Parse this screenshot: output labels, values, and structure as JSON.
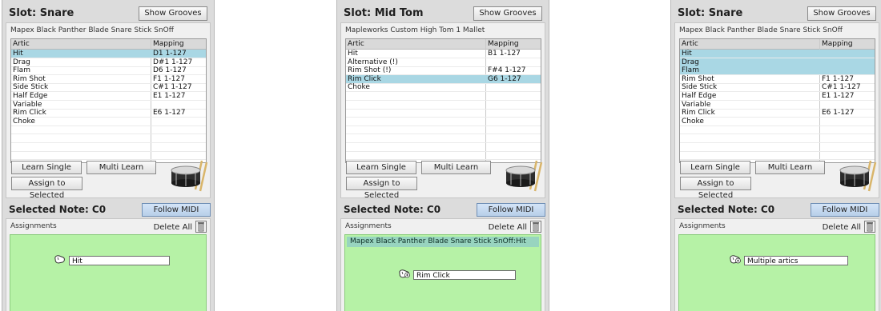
{
  "common": {
    "show_grooves": "Show Grooves",
    "col_artic": "Artic",
    "col_mapping": "Mapping",
    "learn_single": "Learn Single",
    "multi_learn": "Multi Learn",
    "assign_to_selected": "Assign to Selected",
    "selected_note": "Selected Note: C0",
    "follow_midi": "Follow MIDI",
    "assignments": "Assignments",
    "delete_all": "Delete All"
  },
  "colors": {
    "selected_row": "#a9d7e4",
    "drop_zone": "#b6f2a6",
    "assigned_item": "#98d4bf",
    "follow_button": "#c6dbf1"
  },
  "panels": [
    {
      "slot_title": "Slot: Snare",
      "kit_name": "Mapex Black Panther Blade Snare Stick SnOff",
      "rows": [
        {
          "artic": "Hit",
          "mapping": "D1 1-127",
          "selected": true
        },
        {
          "artic": "Drag",
          "mapping": "D#1 1-127",
          "selected": false
        },
        {
          "artic": "Flam",
          "mapping": "D6 1-127",
          "selected": false
        },
        {
          "artic": "Rim Shot",
          "mapping": "F1 1-127",
          "selected": false
        },
        {
          "artic": "Side Stick",
          "mapping": "C#1 1-127",
          "selected": false
        },
        {
          "artic": "Half Edge",
          "mapping": "E1 1-127",
          "selected": false
        },
        {
          "artic": "Variable",
          "mapping": "",
          "selected": false
        },
        {
          "artic": "Rim Click",
          "mapping": "E6 1-127",
          "selected": false
        },
        {
          "artic": "Choke",
          "mapping": "",
          "selected": false
        }
      ],
      "assigned_item": "",
      "drag_label": "Hit",
      "drag_plus": false
    },
    {
      "slot_title": "Slot: Mid Tom",
      "kit_name": "Mapleworks Custom High Tom 1 Mallet",
      "rows": [
        {
          "artic": "Hit",
          "mapping": "B1 1-127",
          "selected": false
        },
        {
          "artic": "Alternative (!)",
          "mapping": "",
          "selected": false
        },
        {
          "artic": "Rim Shot (!)",
          "mapping": "F#4 1-127",
          "selected": false
        },
        {
          "artic": "Rim Click",
          "mapping": "G6 1-127",
          "selected": true
        },
        {
          "artic": "Choke",
          "mapping": "",
          "selected": false
        }
      ],
      "assigned_item": "Mapex Black Panther Blade Snare Stick SnOff:Hit",
      "drag_label": "Rim Click",
      "drag_plus": true
    },
    {
      "slot_title": "Slot: Snare",
      "kit_name": "Mapex Black Panther Blade Snare Stick SnOff",
      "rows": [
        {
          "artic": "Hit",
          "mapping": "",
          "selected": true
        },
        {
          "artic": "Drag",
          "mapping": "",
          "selected": true
        },
        {
          "artic": "Flam",
          "mapping": "",
          "selected": true
        },
        {
          "artic": "Rim Shot",
          "mapping": "F1 1-127",
          "selected": false
        },
        {
          "artic": "Side Stick",
          "mapping": "C#1 1-127",
          "selected": false
        },
        {
          "artic": "Half Edge",
          "mapping": "E1 1-127",
          "selected": false
        },
        {
          "artic": "Variable",
          "mapping": "",
          "selected": false
        },
        {
          "artic": "Rim Click",
          "mapping": "E6 1-127",
          "selected": false
        },
        {
          "artic": "Choke",
          "mapping": "",
          "selected": false
        }
      ],
      "assigned_item": "",
      "drag_label": "Multiple artics",
      "drag_plus": true
    }
  ]
}
